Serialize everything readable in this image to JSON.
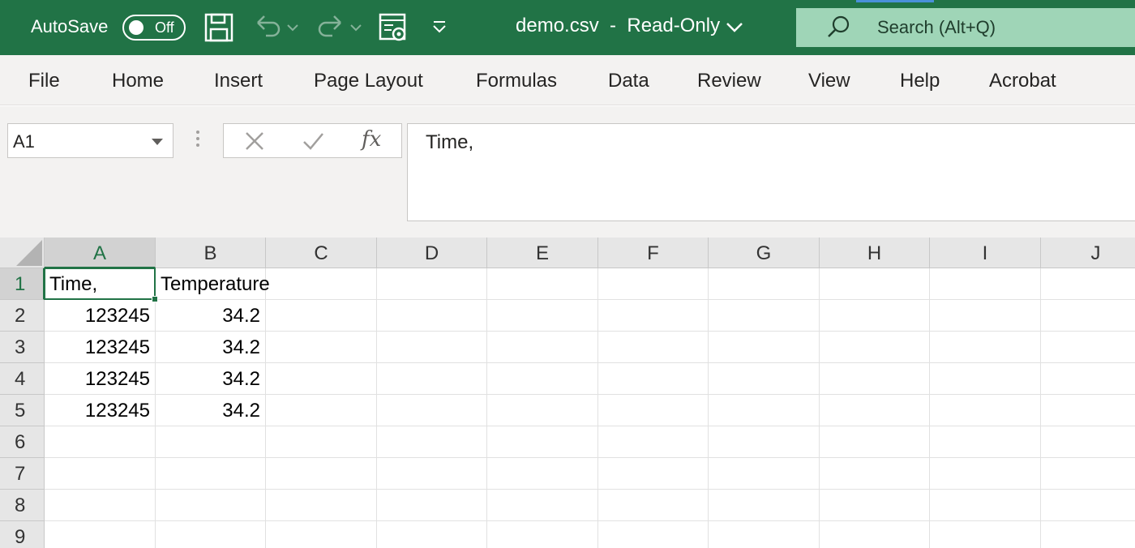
{
  "titlebar": {
    "autosave_label": "AutoSave",
    "autosave_state": "Off",
    "document_title": "demo.csv  -  Read-Only",
    "search_placeholder": "Search (Alt+Q)",
    "bg_color": "#217346",
    "icons": [
      "save-icon",
      "undo-icon",
      "redo-icon",
      "touch-mode-icon",
      "customize-qat-icon",
      "chevron-down-icon",
      "search-icon"
    ]
  },
  "ribbon": {
    "tabs": [
      "File",
      "Home",
      "Insert",
      "Page Layout",
      "Formulas",
      "Data",
      "Review",
      "View",
      "Help",
      "Acrobat"
    ]
  },
  "formula": {
    "name_box": "A1",
    "fx_label": "fx",
    "content": "Time,"
  },
  "grid": {
    "columns": [
      "A",
      "B",
      "C",
      "D",
      "E",
      "F",
      "G",
      "H",
      "I",
      "J"
    ],
    "rows": [
      "1",
      "2",
      "3",
      "4",
      "5",
      "6",
      "7",
      "8",
      "9"
    ],
    "selected_cell": "A1",
    "cells": [
      [
        "Time,",
        "Temperature"
      ],
      [
        "123245",
        "34.2"
      ],
      [
        "123245",
        "34.2"
      ],
      [
        "123245",
        "34.2"
      ],
      [
        "123245",
        "34.2"
      ]
    ]
  }
}
